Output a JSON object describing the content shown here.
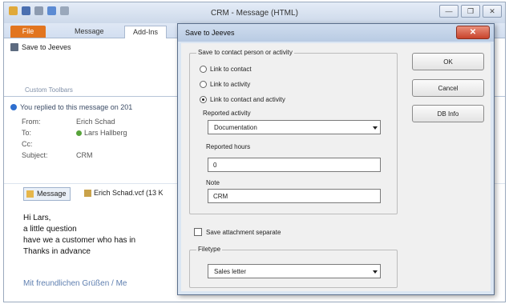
{
  "window": {
    "title": "CRM - Message (HTML)",
    "controls": [
      "—",
      "❐",
      "✕"
    ]
  },
  "ribbon": {
    "tabs": [
      "File",
      "Message",
      "Add-Ins"
    ],
    "save_button": "Save to Jeeves",
    "group_label": "Custom Toolbars"
  },
  "message": {
    "replied_notice": "You replied to this message on 201",
    "from_label": "From:",
    "from_value": "Erich Schad",
    "to_label": "To:",
    "to_value": "Lars Hallberg",
    "cc_label": "Cc:",
    "subject_label": "Subject:",
    "subject_value": "CRM",
    "attachment_tab": "Message",
    "attachment_file": "Erich Schad.vcf (13 K",
    "body_lines": [
      "Hi Lars,",
      "a little question",
      "have we a customer who has in",
      "Thanks in advance"
    ],
    "signature": "Mit freundlichen Grüßen / Me"
  },
  "dialog": {
    "title": "Save to Jeeves",
    "close_symbol": "✕",
    "group_save_to": "Save to contact person or activity",
    "radio_contact": "Link to contact",
    "radio_activity": "Link to activity",
    "radio_both": "Link to contact and activity",
    "reported_activity_label": "Reported activity",
    "reported_activity_value": "Documentation",
    "reported_hours_label": "Reported hours",
    "reported_hours_value": "0",
    "note_label": "Note",
    "note_value": "CRM",
    "save_attachment_label": "Save attachment separate",
    "filetype_group": "Filetype",
    "filetype_value": "Sales letter",
    "ok": "OK",
    "cancel": "Cancel",
    "db_info": "DB Info"
  }
}
